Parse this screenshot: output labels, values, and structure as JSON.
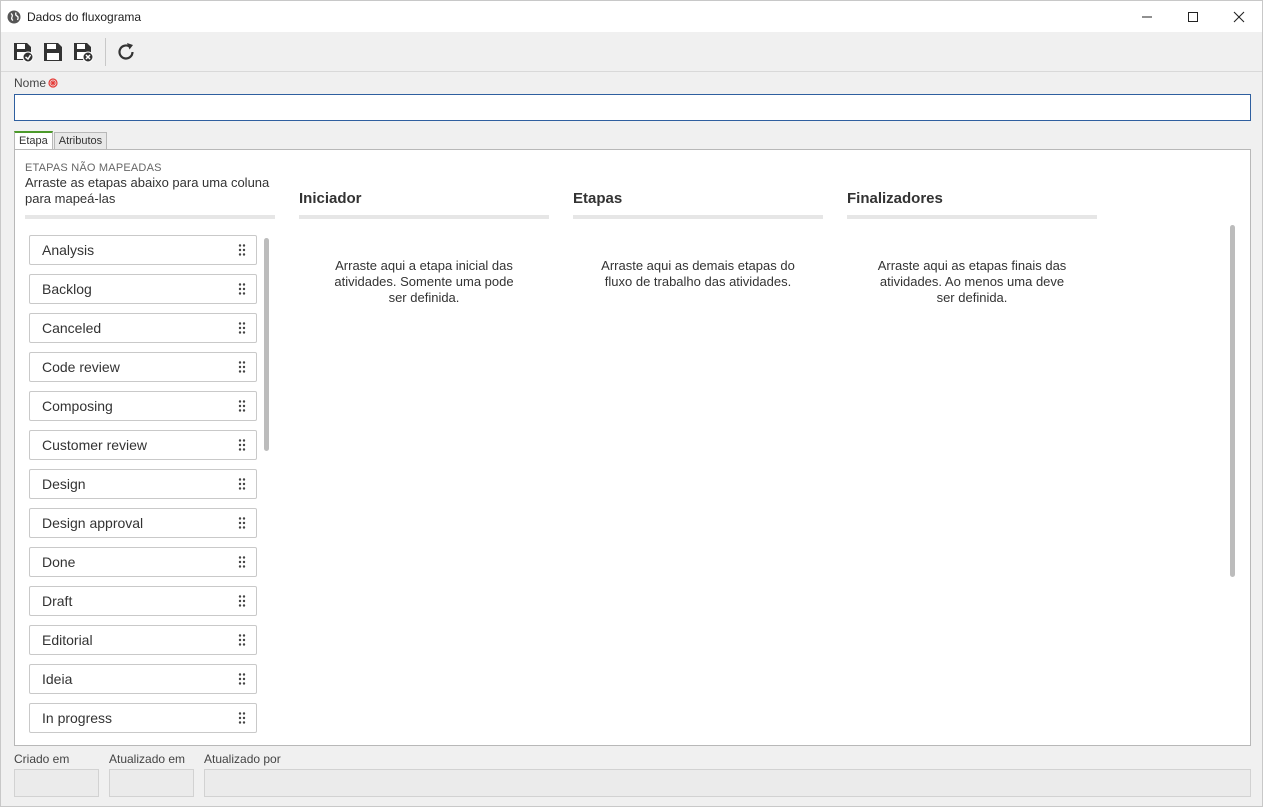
{
  "window": {
    "title": "Dados do fluxograma",
    "controls": [
      "minimize-icon",
      "maximize-icon",
      "close-icon"
    ]
  },
  "toolbar": {
    "buttons": [
      {
        "name": "save-and-new-button",
        "icon": "save-new-icon"
      },
      {
        "name": "save-button",
        "icon": "save-icon"
      },
      {
        "name": "save-and-close-button",
        "icon": "save-close-icon"
      },
      {
        "name": "refresh-button",
        "icon": "refresh-icon"
      }
    ]
  },
  "form": {
    "name_label": "Nome",
    "name_value": "",
    "name_placeholder": "",
    "required_color": "#e53935"
  },
  "tabs": [
    {
      "label": "Etapa",
      "active": true
    },
    {
      "label": "Atributos",
      "active": false
    }
  ],
  "unmapped": {
    "caption": "ETAPAS NÃO MAPEADAS",
    "description": "Arraste as etapas abaixo para uma coluna para mapeá-las",
    "items": [
      "Analysis",
      "Backlog",
      "Canceled",
      "Code review",
      "Composing",
      "Customer review",
      "Design",
      "Design approval",
      "Done",
      "Draft",
      "Editorial",
      "Ideia",
      "In progress"
    ]
  },
  "columns": [
    {
      "title": "Iniciador",
      "hint": "Arraste aqui a etapa inicial das atividades. Somente uma pode ser definida."
    },
    {
      "title": "Etapas",
      "hint": "Arraste aqui as demais etapas do fluxo de trabalho das atividades."
    },
    {
      "title": "Finalizadores",
      "hint": "Arraste aqui as etapas finais das atividades. Ao menos uma deve ser definida."
    }
  ],
  "footer": {
    "created_label": "Criado em",
    "created_value": "",
    "updated_label": "Atualizado em",
    "updated_value": "",
    "updated_by_label": "Atualizado por",
    "updated_by_value": ""
  },
  "colors": {
    "accent_tab": "#4c9a2a",
    "input_border": "#2f5f9f"
  }
}
